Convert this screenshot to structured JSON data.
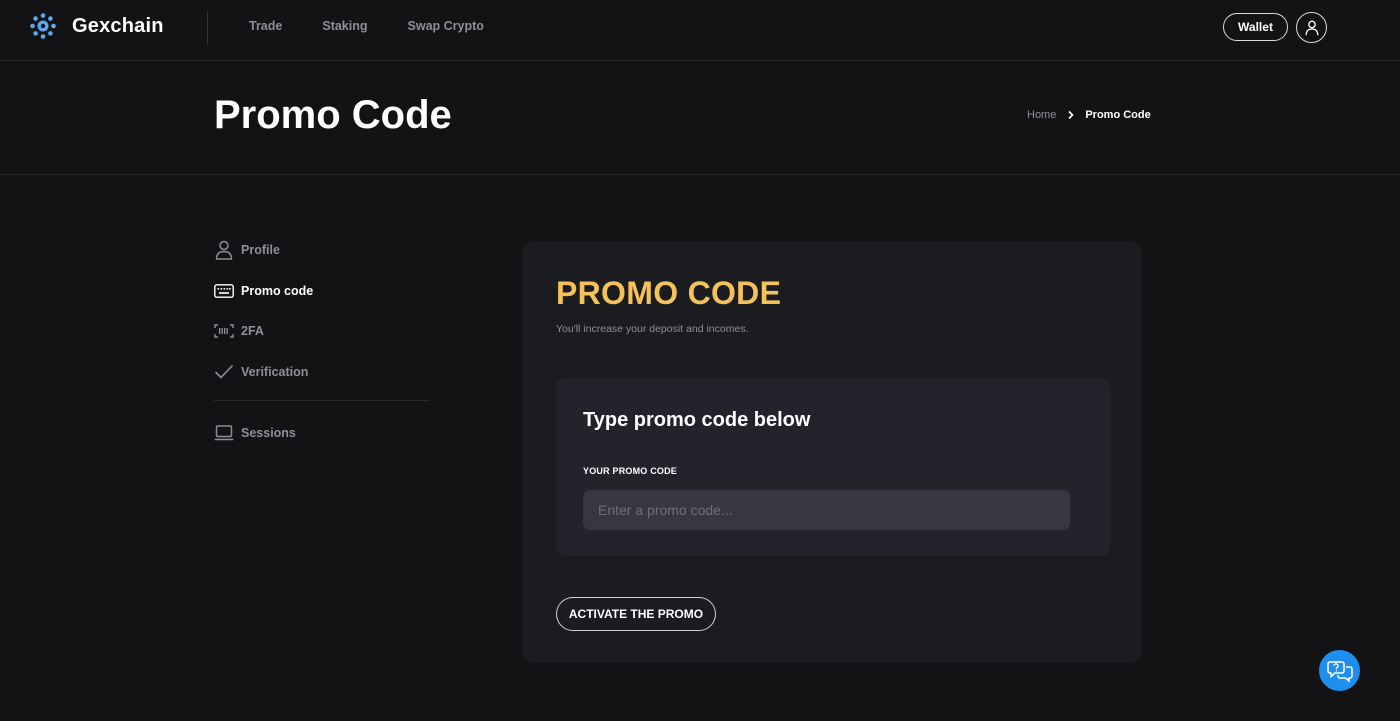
{
  "brand": {
    "name": "Gexchain",
    "icon": "gexchain-logo-icon",
    "accent": "#5aa9f5"
  },
  "nav": {
    "links": [
      {
        "label": "Trade"
      },
      {
        "label": "Staking"
      },
      {
        "label": "Swap Crypto"
      }
    ],
    "wallet_label": "Wallet",
    "user_icon": "user-icon"
  },
  "header": {
    "title": "Promo Code",
    "breadcrumb": {
      "home": "Home",
      "current": "Promo Code"
    }
  },
  "sidebar": {
    "items": [
      {
        "label": "Profile",
        "icon": "user-icon",
        "active": false
      },
      {
        "label": "Promo code",
        "icon": "keyboard-icon",
        "active": true
      },
      {
        "label": "2FA",
        "icon": "barcode-scan-icon",
        "active": false
      },
      {
        "label": "Verification",
        "icon": "checkmark-icon",
        "active": false
      },
      {
        "label": "Sessions",
        "icon": "laptop-icon",
        "active": false
      }
    ]
  },
  "promo": {
    "title": "PROMO CODE",
    "subtitle": "You'll increase your deposit and incomes.",
    "box_title": "Type promo code below",
    "field_label": "YOUR PROMO CODE",
    "placeholder": "Enter a promo code...",
    "value": "",
    "button_label": "ACTIVATE THE PROMO"
  },
  "chat": {
    "icon": "chat-support-icon"
  },
  "colors": {
    "background": "#131316",
    "card": "#1b1c20",
    "inner_card": "#23242b",
    "input": "#363742",
    "title_accent": "#f5c25a",
    "chat_button": "#1f8fef",
    "muted_text": "#8d8f99"
  }
}
